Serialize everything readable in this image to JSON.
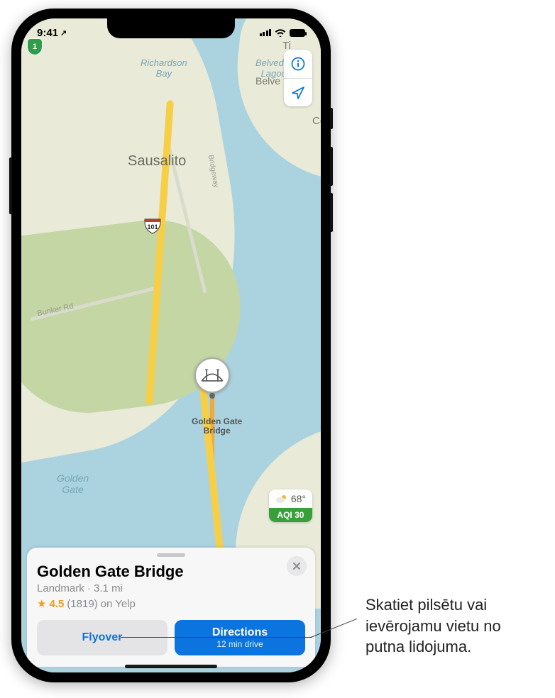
{
  "status": {
    "time": "9:41",
    "loc_arrow": "↗"
  },
  "map": {
    "labels": {
      "sausalito": "Sausalito",
      "richardson_bay": "Richardson\nBay",
      "belvedere_lagoon": "Belvedere\nLagoon",
      "tiburon_prefix": "Ti",
      "belvedere_prefix": "Belve",
      "corte_prefix": "Co",
      "ggb": "Golden Gate\nBridge",
      "golden_gate": "Golden\nGate",
      "bunker_rd": "Bunker Rd",
      "bridgeway": "Bridgeway"
    },
    "shields": {
      "ca1": "1",
      "us101": "101"
    }
  },
  "weather": {
    "temp": "68°",
    "aqi": "AQI 30"
  },
  "card": {
    "title": "Golden Gate Bridge",
    "category": "Landmark",
    "dot": "·",
    "distance": "3.1 mi",
    "rating_value": "4.5",
    "rating_count": "(1819)",
    "rating_source": "on Yelp",
    "flyover_label": "Flyover",
    "directions_label": "Directions",
    "directions_sub": "12 min drive"
  },
  "callout": {
    "text": "Skatiet pilsētu vai ievērojamu vietu no putna lidojuma."
  }
}
